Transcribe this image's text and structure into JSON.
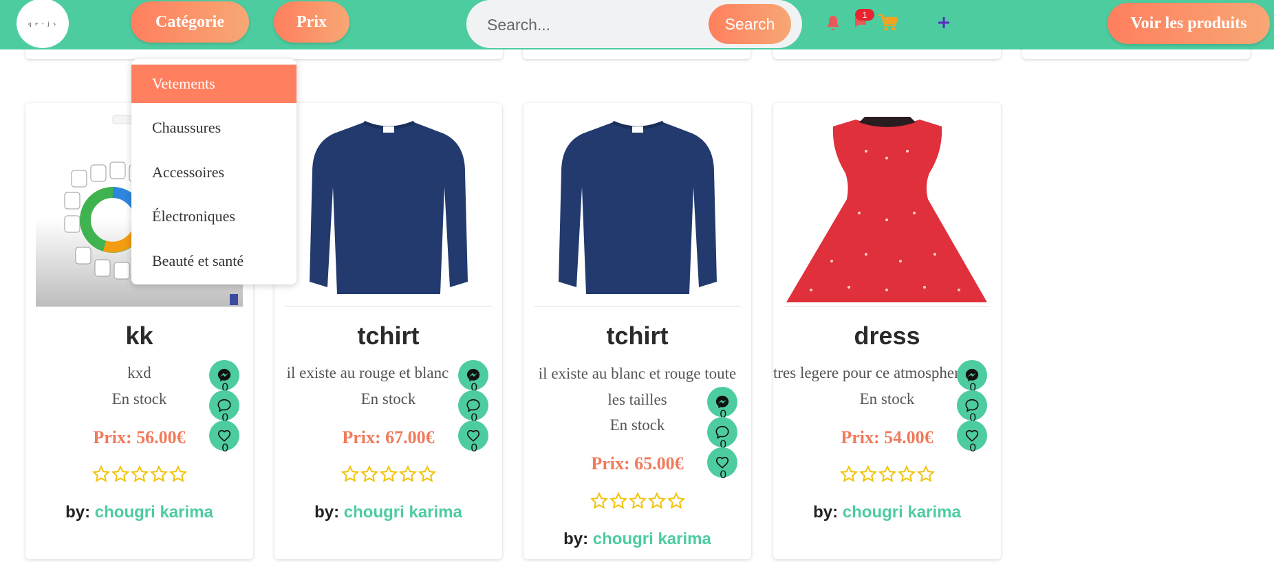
{
  "header": {
    "logo_text": "q e - j s",
    "category_label": "Catégorie",
    "price_label": "Prix",
    "search_placeholder": "Search...",
    "search_button": "Search",
    "notification_badge": "1",
    "view_products_label": "Voir les produits"
  },
  "category_menu": {
    "items": [
      "Vetements",
      "Chaussures",
      "Accessoires",
      "Électroniques",
      "Beauté et santé"
    ],
    "selected": "Vetements"
  },
  "icons": {
    "bell": "bell-icon",
    "chat": "chat-icon",
    "cart": "cart-icon",
    "add": "plus-icon",
    "messenger": "messenger-icon",
    "comment": "comment-icon",
    "like": "heart-icon",
    "star": "star-icon"
  },
  "colors": {
    "header": "#4dcc9f",
    "accent": "#ff7f5e",
    "price": "#f07a5a",
    "author": "#4dcc9f",
    "stars": "#f1c40f"
  },
  "products": [
    {
      "name": "kk",
      "description": "kxd",
      "stock": "En stock",
      "price": "Prix: 56.00€",
      "rating": 0,
      "author_prefix": "by:",
      "author": "chougri karima",
      "counts": {
        "messenger": "0",
        "comments": "0",
        "likes": "0"
      }
    },
    {
      "name": "tchirt",
      "description": "il existe au rouge et blanc",
      "stock": "En stock",
      "price": "Prix: 67.00€",
      "rating": 0,
      "author_prefix": "by:",
      "author": "chougri karima",
      "counts": {
        "messenger": "0",
        "comments": "0",
        "likes": "0"
      }
    },
    {
      "name": "tchirt",
      "description": "il existe au blanc et rouge toute les tailles",
      "stock": "En stock",
      "price": "Prix: 65.00€",
      "rating": 0,
      "author_prefix": "by:",
      "author": "chougri karima",
      "counts": {
        "messenger": "0",
        "comments": "0",
        "likes": "0"
      }
    },
    {
      "name": "dress",
      "description": "tres legere pour ce atmosphere",
      "stock": "En stock",
      "price": "Prix: 54.00€",
      "rating": 0,
      "author_prefix": "by:",
      "author": "chougri karima",
      "counts": {
        "messenger": "0",
        "comments": "0",
        "likes": "0"
      }
    }
  ]
}
